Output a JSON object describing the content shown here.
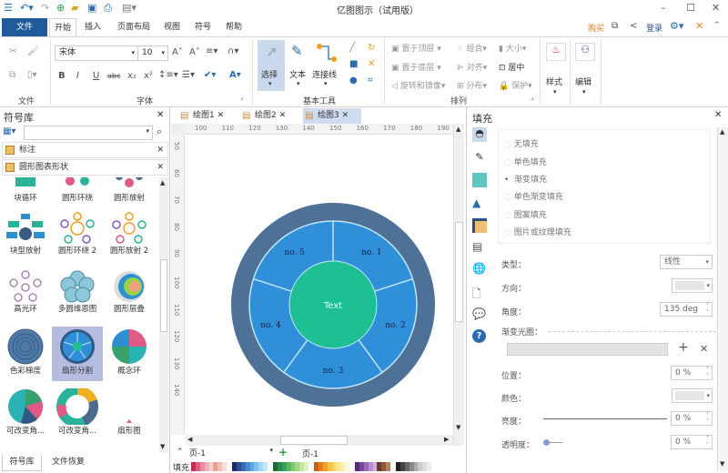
{
  "app": {
    "title": "亿图图示（试用版）"
  },
  "menu_tabs": [
    {
      "label": "文件"
    },
    {
      "label": "开始"
    },
    {
      "label": "插入"
    },
    {
      "label": "页面布局"
    },
    {
      "label": "视图"
    },
    {
      "label": "符号"
    },
    {
      "label": "帮助"
    }
  ],
  "topright": {
    "buy": "购买",
    "login": "登录"
  },
  "ribbon": {
    "groups": {
      "file": "文件",
      "font": "字体",
      "basic_tools": "基本工具",
      "arrange": "排列"
    },
    "font_name": "宋体",
    "font_size": "10",
    "select": "选择",
    "text": "文本",
    "connector": "连接线",
    "bring_front": "置于顶层",
    "send_back": "置于底层",
    "rotate_mirror": "旋转和镜像",
    "group": "组合",
    "align": "对齐",
    "distribute": "分布",
    "size": "大小",
    "center": "居中",
    "protect": "保护",
    "style": "样式",
    "edit": "编辑"
  },
  "left_panel": {
    "title": "符号库",
    "search_value": "",
    "categories": [
      {
        "label": "标注"
      },
      {
        "label": "圆形图表形状"
      }
    ],
    "items": [
      {
        "label": "块循环"
      },
      {
        "label": "圆形环绕"
      },
      {
        "label": "圆形放射"
      },
      {
        "label": "块型放射"
      },
      {
        "label": "圆形环绕 2"
      },
      {
        "label": "圆形放射 2"
      },
      {
        "label": "高光环"
      },
      {
        "label": "多圆维恩图"
      },
      {
        "label": "圆形层叠"
      },
      {
        "label": "色彩梯度"
      },
      {
        "label": "扇形分割"
      },
      {
        "label": "概念环"
      },
      {
        "label": "可改变角..."
      },
      {
        "label": "可改变角..."
      },
      {
        "label": "扇形图"
      }
    ],
    "selected_item": "扇形分割",
    "bottom_tabs": [
      {
        "label": "符号库"
      },
      {
        "label": "文件恢复"
      }
    ]
  },
  "doc_tabs": [
    {
      "label": "绘图1"
    },
    {
      "label": "绘图2"
    },
    {
      "label": "绘图3"
    }
  ],
  "active_doc": "绘图3",
  "ruler": {
    "h": [
      "100",
      "110",
      "120",
      "130",
      "140",
      "150",
      "160",
      "170",
      "180",
      "190"
    ],
    "v": [
      "50",
      "60",
      "70",
      "80",
      "90",
      "100",
      "110",
      "120",
      "130",
      "140"
    ]
  },
  "diagram": {
    "center_text": "Text",
    "segments": [
      "no. 1",
      "no. 2",
      "no. 3",
      "no. 4",
      "no. 5"
    ],
    "colors": {
      "outer": "#4e7198",
      "segment": "#2f8fd8",
      "center": "#1fbf94",
      "line": "#bfe6f7"
    }
  },
  "page_bar": {
    "page_select": "页-1",
    "page_tab": "页-1",
    "fill_label": "填充"
  },
  "right_panel": {
    "title": "填充",
    "fill_options": [
      {
        "label": "无填充"
      },
      {
        "label": "单色填充"
      },
      {
        "label": "渐变填充"
      },
      {
        "label": "单色渐变填充"
      },
      {
        "label": "图案填充"
      },
      {
        "label": "图片或纹理填充"
      }
    ],
    "selected_fill": "渐变填充",
    "type_label": "类型：",
    "type_value": "线性",
    "direction_label": "方向：",
    "angle_label": "角度：",
    "angle_value": "135 deg",
    "gradient_stops_label": "渐变光圈：",
    "position_label": "位置：",
    "position_value": "0 %",
    "color_label": "颜色：",
    "brightness_label": "亮度：",
    "brightness_value": "0 %",
    "transparency_label": "透明度：",
    "transparency_value": "0 %"
  }
}
